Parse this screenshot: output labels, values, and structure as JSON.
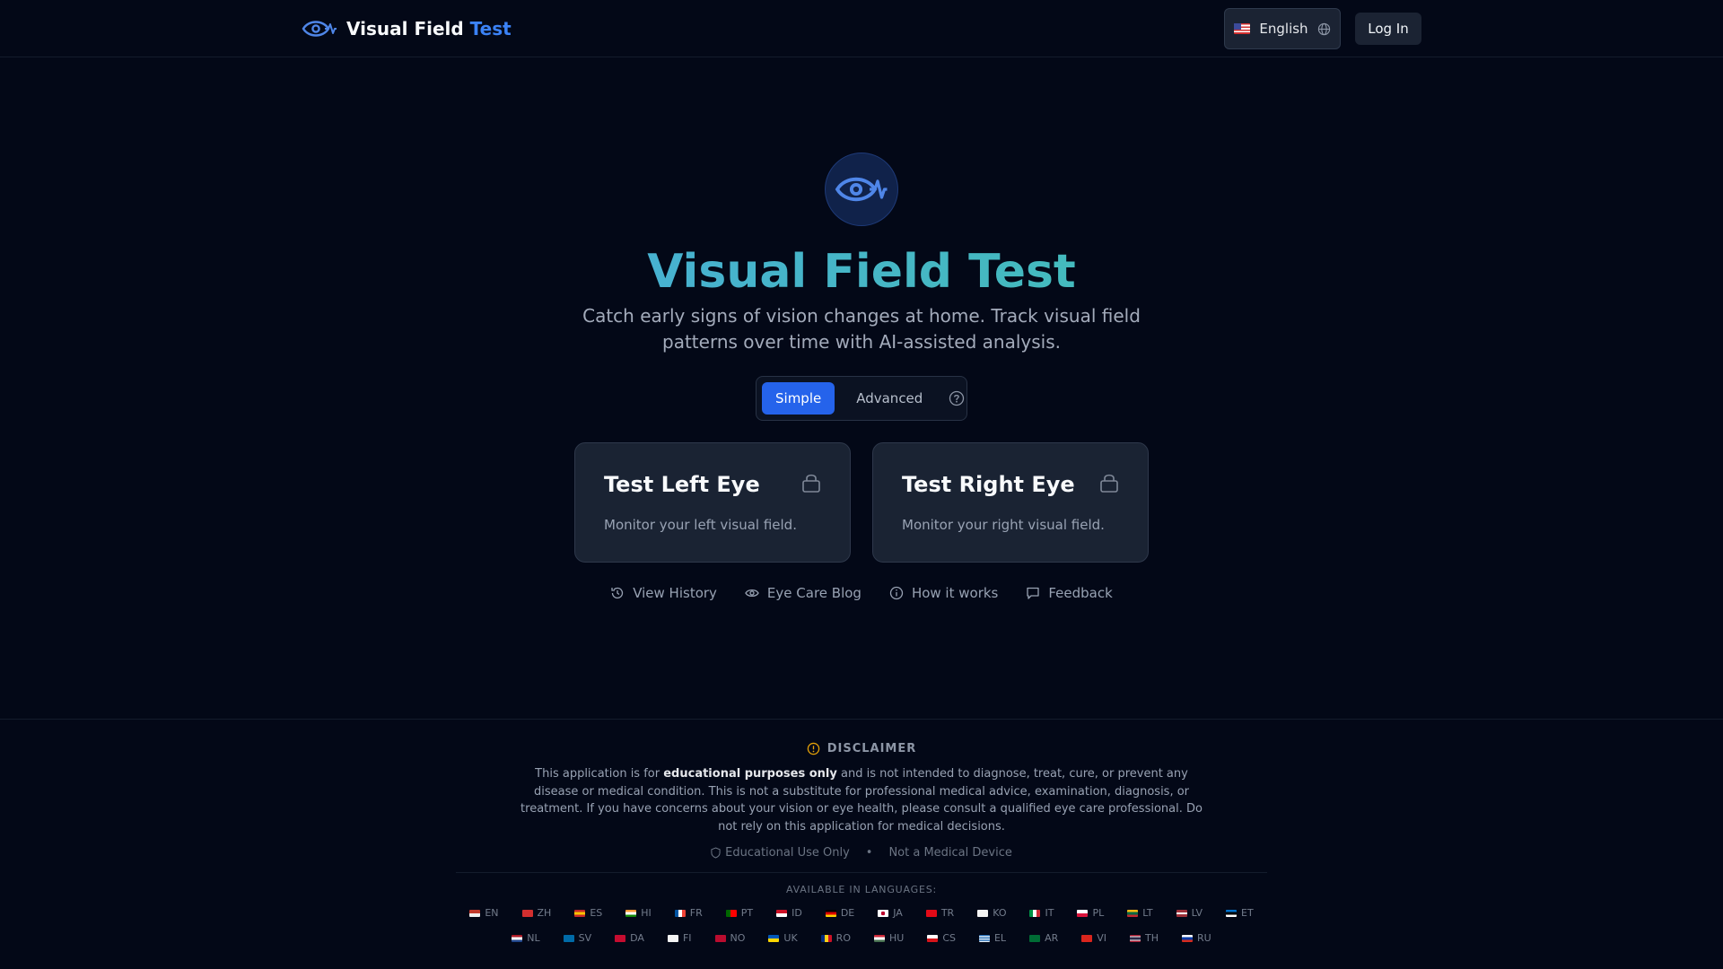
{
  "header": {
    "brand_main": "Visual Field",
    "brand_accent": "Test",
    "language_label": "English",
    "login_label": "Log In"
  },
  "hero": {
    "title": "Visual Field Test",
    "subtitle": "Catch early signs of vision changes at home. Track visual field patterns over time with AI-assisted analysis."
  },
  "mode_toggle": {
    "simple": "Simple",
    "advanced": "Advanced",
    "active": "Simple"
  },
  "cards": [
    {
      "title": "Test Left Eye",
      "description": "Monitor your left visual field."
    },
    {
      "title": "Test Right Eye",
      "description": "Monitor your right visual field."
    }
  ],
  "links": {
    "history": "View History",
    "blog": "Eye Care Blog",
    "how": "How it works",
    "feedback": "Feedback"
  },
  "disclaimer": {
    "heading": "DISCLAIMER",
    "text_before": "This application is for ",
    "text_bold": "educational purposes only",
    "text_after": " and is not intended to diagnose, treat, cure, or prevent any disease or medical condition. This is not a substitute for professional medical advice, examination, diagnosis, or treatment. If you have concerns about your vision or eye health, please consult a qualified eye care professional. Do not rely on this application for medical decisions.",
    "badge_educational": "Educational Use Only",
    "separator": "•",
    "badge_medical": "Not a Medical Device"
  },
  "languages": {
    "label": "AVAILABLE IN LANGUAGES:",
    "row1": [
      "EN",
      "ZH",
      "ES",
      "HI",
      "FR",
      "PT",
      "ID",
      "DE",
      "JA",
      "TR",
      "KO",
      "IT",
      "PL",
      "LT",
      "LV",
      "ET"
    ],
    "row2": [
      "NL",
      "SV",
      "DA",
      "FI",
      "NO",
      "UK",
      "RO",
      "HU",
      "CS",
      "EL",
      "AR",
      "VI",
      "TH",
      "RU"
    ]
  },
  "colors": {
    "background": "#030817",
    "accent": "#3b82f6",
    "active_toggle": "#2563eb",
    "card_bg": "#1a2333",
    "title_gradient_start": "#4aa3f0",
    "title_gradient_end": "#3dc6a4"
  },
  "icons": {
    "brand": "eye-pulse-icon",
    "language": "globe-icon",
    "help": "question-circle-icon",
    "card": "lock-icon",
    "history": "history-icon",
    "blog": "eye-icon",
    "how": "info-icon",
    "feedback": "message-square-icon",
    "disclaimer": "alert-circle-icon",
    "badge": "shield-icon"
  }
}
